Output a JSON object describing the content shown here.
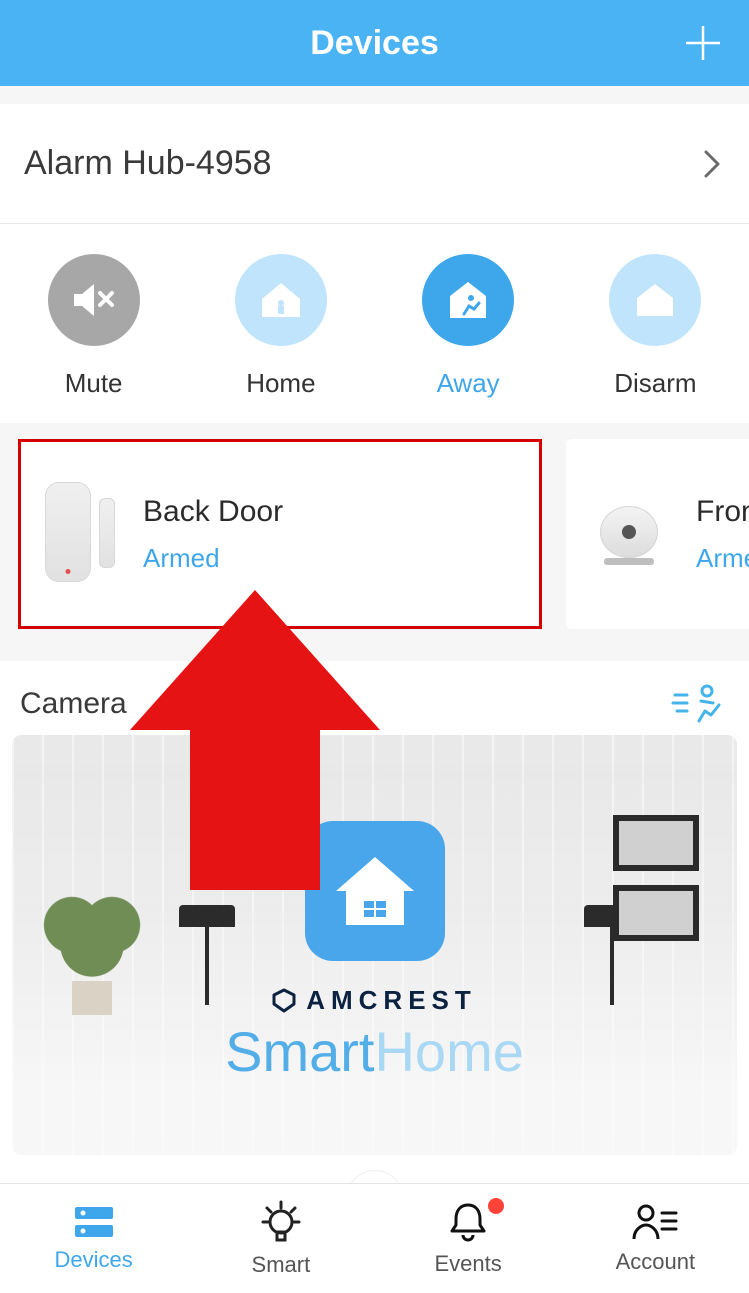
{
  "header": {
    "title": "Devices"
  },
  "hub": {
    "name": "Alarm Hub-4958"
  },
  "modes": {
    "mute": "Mute",
    "home": "Home",
    "away": "Away",
    "disarm": "Disarm",
    "active": "away"
  },
  "devices": [
    {
      "name": "Back Door",
      "status": "Armed",
      "type": "door-sensor"
    },
    {
      "name": "Front",
      "status": "Armed",
      "type": "camera"
    }
  ],
  "camera_section": {
    "title": "Camera"
  },
  "brand": {
    "name": "AMCREST",
    "product_a": "Smart",
    "product_b": "Home"
  },
  "tabs": {
    "devices": "Devices",
    "smart": "Smart",
    "events": "Events",
    "account": "Account",
    "active": "devices",
    "events_has_notification": true
  },
  "annotation": {
    "type": "red-arrow",
    "points_to": "devices.0"
  }
}
